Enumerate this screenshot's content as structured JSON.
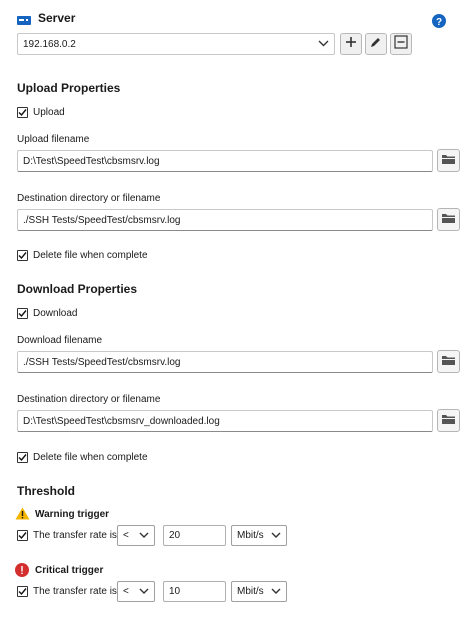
{
  "server": {
    "title": "Server",
    "address": "192.168.0.2",
    "icons": [
      "server-icon",
      "help-icon",
      "add-icon",
      "edit-icon",
      "remove-icon",
      "chevron-down-icon"
    ],
    "accent_color": "#1565c0"
  },
  "upload": {
    "title": "Upload Properties",
    "enable_label": "Upload",
    "enable_checked": true,
    "filename_label": "Upload filename",
    "filename_value": "D:\\Test\\SpeedTest\\cbsmsrv.log",
    "dest_label": "Destination directory or filename",
    "dest_value": "./SSH Tests/SpeedTest/cbsmsrv.log",
    "delete_label": "Delete file when complete",
    "delete_checked": true
  },
  "download": {
    "title": "Download Properties",
    "enable_label": "Download",
    "enable_checked": true,
    "filename_label": "Download filename",
    "filename_value": "./SSH Tests/SpeedTest/cbsmsrv.log",
    "dest_label": "Destination directory or filename",
    "dest_value": "D:\\Test\\SpeedTest\\cbsmsrv_downloaded.log",
    "delete_label": "Delete file when complete",
    "delete_checked": true
  },
  "threshold": {
    "title": "Threshold",
    "warning": {
      "title": "Warning trigger",
      "icon": "warning-icon",
      "icon_color": "#f5b400",
      "rate_label": "The transfer rate is",
      "checked": true,
      "operator": "<",
      "value": "20",
      "unit": "Mbit/s"
    },
    "critical": {
      "title": "Critical trigger",
      "icon": "error-icon",
      "icon_color": "#d32f2f",
      "rate_label": "The transfer rate is",
      "checked": true,
      "operator": "<",
      "value": "10",
      "unit": "Mbit/s"
    }
  }
}
